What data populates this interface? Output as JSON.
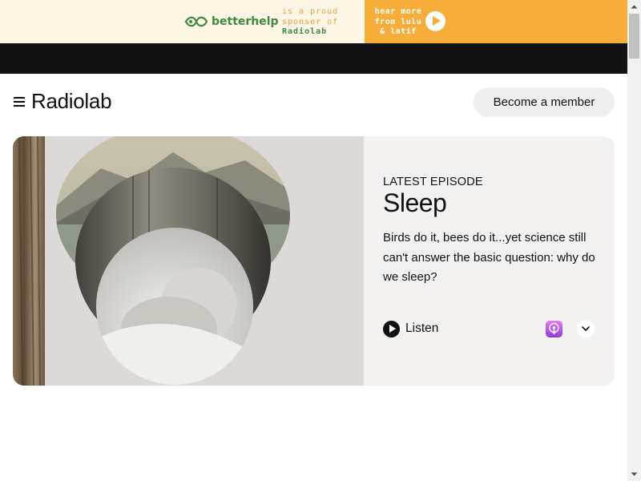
{
  "ad": {
    "brand": "betterhelp",
    "sponsor_line1": "is a proud",
    "sponsor_line2": "sponsor of",
    "sponsor_line3": "Radiolab",
    "cta_line1": "hear more",
    "cta_line2": "from lulu",
    "cta_line3": "& latif",
    "brand_color": "#3d8b3d",
    "cta_color": "#f6ad3a"
  },
  "header": {
    "menu_icon": "hamburger-menu-icon",
    "logo": "Radiolab",
    "member_button": "Become a member"
  },
  "episode": {
    "eyebrow": "LATEST EPISODE",
    "title": "Sleep",
    "description": "Birds do it, bees do it...yet science still can't answer the basic question: why do we sleep?",
    "listen_label": "Listen",
    "podcast_icon": "apple-podcasts-icon",
    "expand_icon": "chevron-down-icon"
  },
  "colors": {
    "card_bg": "#f3f2f1",
    "text": "#111111",
    "button_bg": "#f0efee"
  }
}
